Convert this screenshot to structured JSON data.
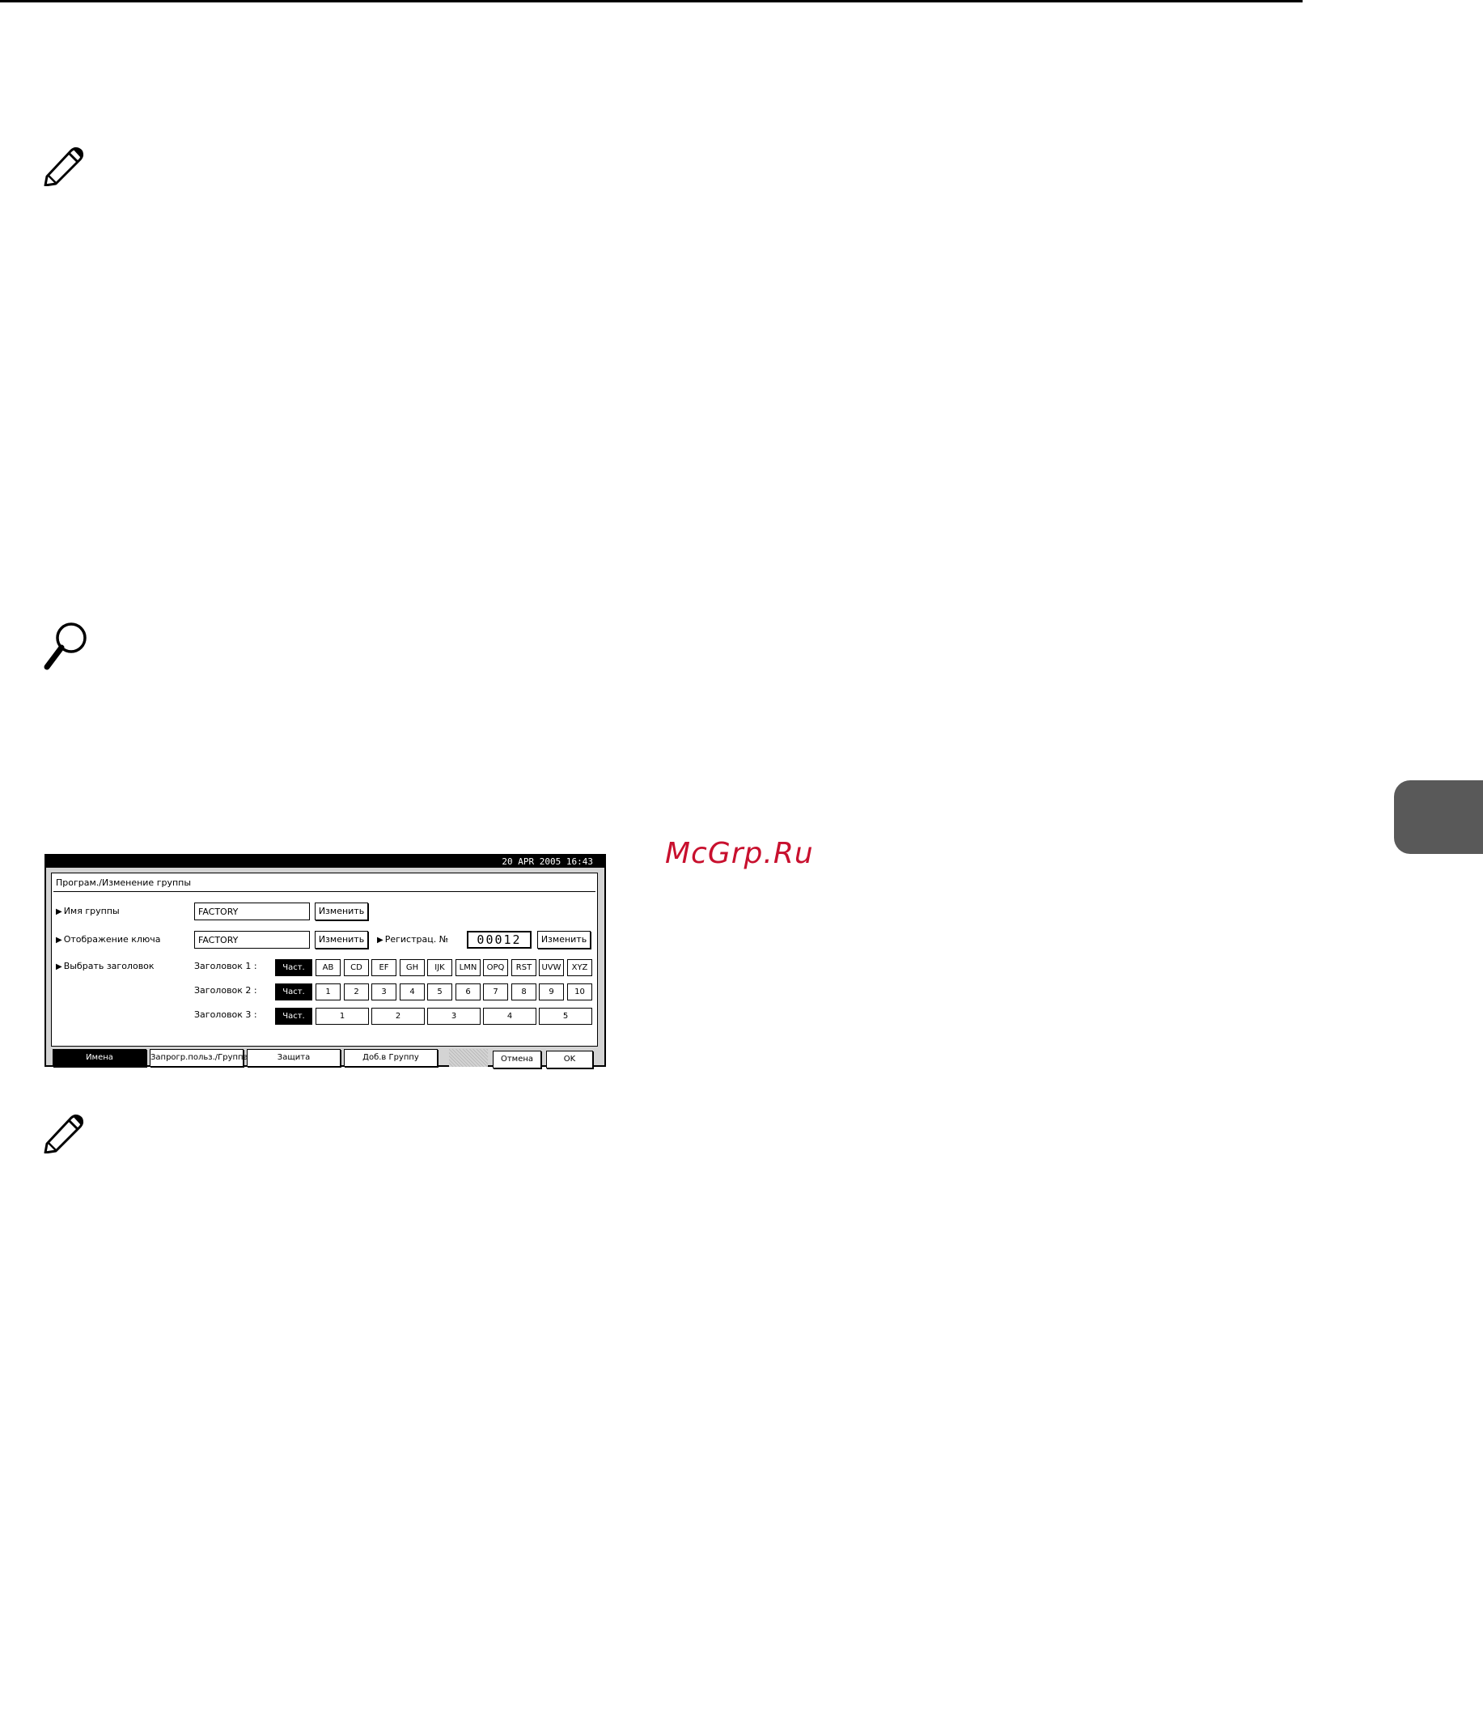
{
  "panel": {
    "datetime": "20  APR   2005 16:43",
    "title": "Програм./Изменение группы",
    "rows": {
      "group_name": {
        "label": "Имя группы",
        "value": "FACTORY",
        "button": "Изменить"
      },
      "key_display": {
        "label": "Отображение ключа",
        "value": "FACTORY",
        "button": "Изменить"
      },
      "registration": {
        "label": "Регистрац. №",
        "value": "00012",
        "button": "Изменить"
      },
      "select_heading": {
        "label": "Выбрать заголовок"
      }
    },
    "headings": [
      {
        "label": "Заголовок  1 :",
        "frequent": "Част.",
        "keys": [
          "AB",
          "CD",
          "EF",
          "GH",
          "IJK",
          "LMN",
          "OPQ",
          "RST",
          "UVW",
          "XYZ"
        ]
      },
      {
        "label": "Заголовок  2 :",
        "frequent": "Част.",
        "keys": [
          "1",
          "2",
          "3",
          "4",
          "5",
          "6",
          "7",
          "8",
          "9",
          "10"
        ]
      },
      {
        "label": "Заголовок  3 :",
        "frequent": "Част.",
        "keys": [
          "1",
          "2",
          "3",
          "4",
          "5"
        ]
      }
    ],
    "tabs": [
      "Имена",
      "Запрогр.польз./Группа",
      "Защита",
      "Доб.в Группу"
    ],
    "cancel": "Отмена",
    "ok": "OK"
  },
  "watermark": "McGrp.Ru",
  "icons": {
    "note": "pencil-note-icon",
    "reference": "magnifier-reference-icon"
  },
  "colors": {
    "watermark": "#c8102e",
    "side_tab": "#595959"
  }
}
